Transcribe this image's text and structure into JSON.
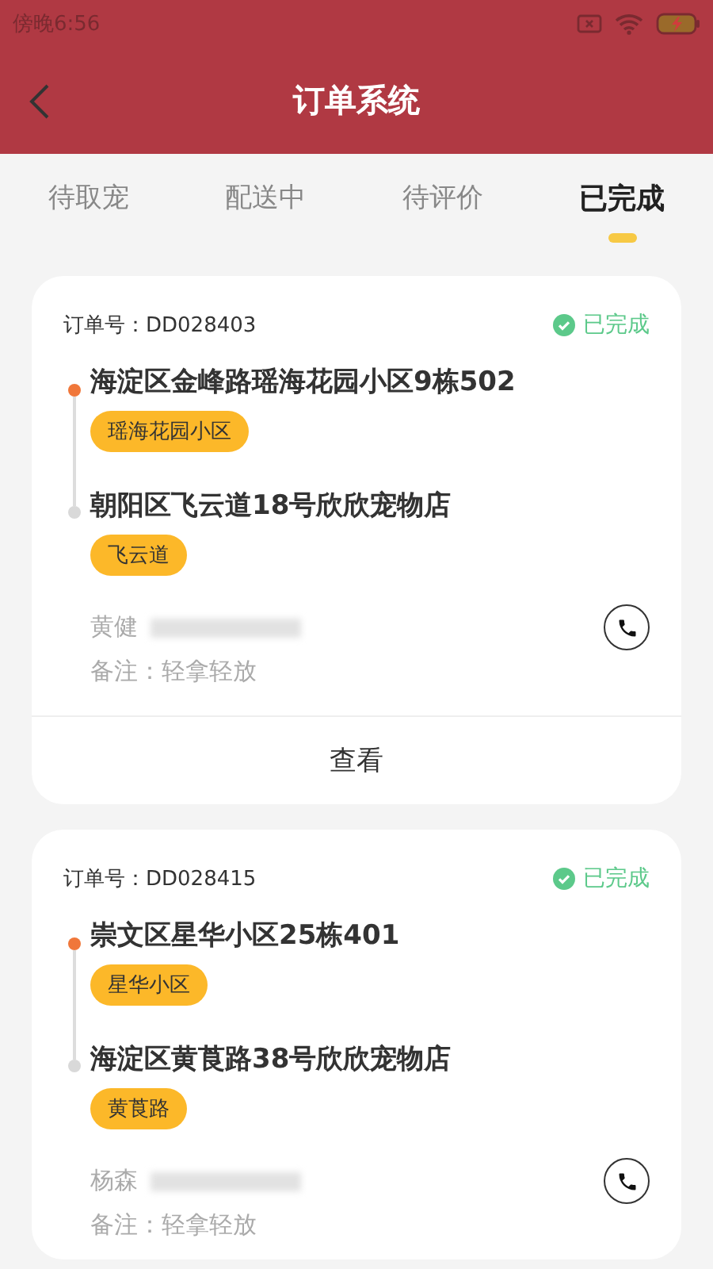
{
  "status_bar": {
    "time": "傍晚6:56"
  },
  "header": {
    "title": "订单系统"
  },
  "tabs": [
    {
      "label": "待取宠",
      "selected": false
    },
    {
      "label": "配送中",
      "selected": false
    },
    {
      "label": "待评价",
      "selected": false
    },
    {
      "label": "已完成",
      "selected": true
    }
  ],
  "orders": [
    {
      "order_no": "订单号：DD028403",
      "status": "已完成",
      "pickup": {
        "address": "海淀区金峰路瑶海花园小区9栋502",
        "tag": "瑶海花园小区"
      },
      "dropoff": {
        "address": "朝阳区飞云道18号欣欣宠物店",
        "tag": "飞云道"
      },
      "contact": "黄健",
      "note": "备注：轻拿轻放",
      "action": "查看"
    },
    {
      "order_no": "订单号：DD028415",
      "status": "已完成",
      "pickup": {
        "address": "崇文区星华小区25栋401",
        "tag": "星华小区"
      },
      "dropoff": {
        "address": "海淀区黄莨路38号欣欣宠物店",
        "tag": "黄莨路"
      },
      "contact": "杨森",
      "note": "备注：轻拿轻放"
    }
  ]
}
